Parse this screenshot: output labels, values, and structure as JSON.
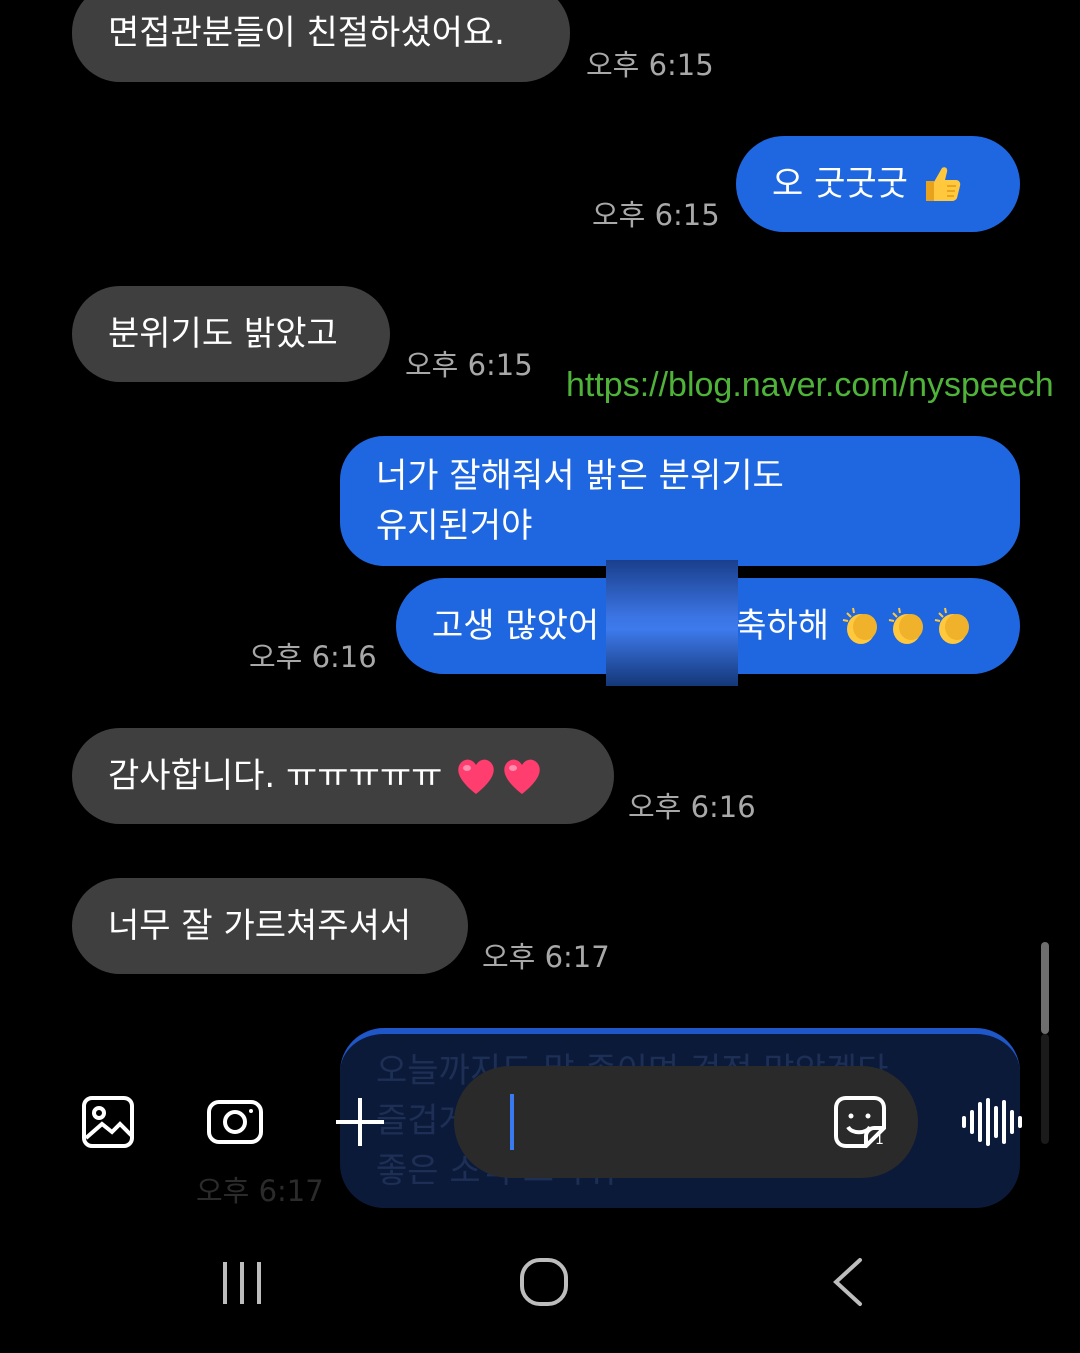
{
  "messages": [
    {
      "text": "면접관분들이 친절하셨어요.",
      "time": "오후 6:15"
    },
    {
      "text": "오 굿굿굿",
      "time": "오후 6:15"
    },
    {
      "text": "분위기도 밝았고",
      "time": "오후 6:15"
    },
    {
      "line1": "너가 잘해줘서 밝은 분위기도",
      "line2": "유지된거야"
    },
    {
      "text_before": "고생 많았어",
      "text_after": "축하해",
      "time": "오후 6:16"
    },
    {
      "text": "감사합니다. ㅠㅠㅠㅠㅠ",
      "time": "오후 6:16"
    },
    {
      "text": "너무 잘 가르쳐주셔서",
      "time": "오후 6:17"
    }
  ],
  "faded_message": {
    "lines": [
      "오늘까지도 말 좀이며 걱정 많았겠다.",
      "즐겁게",
      "좋은 소식 고마워"
    ],
    "time": "오후 6:17"
  },
  "watermark": "https://blog.naver.com/nyspeech",
  "input": {
    "placeholder": ""
  },
  "icons": {
    "gallery": "image-icon",
    "camera": "camera-icon",
    "plus": "plus-icon",
    "sticker": "sticker-icon",
    "voice": "voice-wave-icon",
    "recent": "recent-apps-icon",
    "home": "home-icon",
    "back": "back-icon"
  },
  "colors": {
    "sent_bubble": "#1f67e0",
    "received_bubble": "#3f3f3f",
    "background": "#000000",
    "watermark": "#4fb33a"
  }
}
